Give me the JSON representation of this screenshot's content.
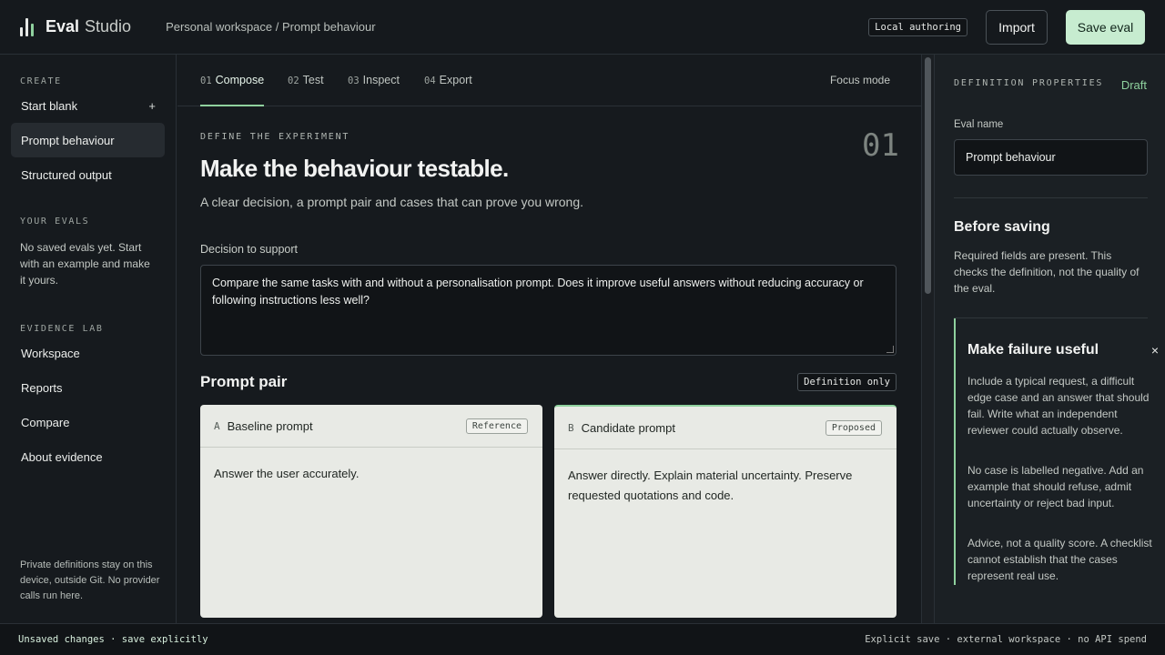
{
  "app": {
    "name_bold": "Eval",
    "name_light": "Studio",
    "breadcrumb": "Personal workspace / Prompt behaviour"
  },
  "topbar": {
    "mode_badge": "Local authoring",
    "import_label": "Import",
    "save_label": "Save eval"
  },
  "sidebar": {
    "create_heading": "CREATE",
    "start_blank": "Start blank",
    "plus": "+",
    "create_items": [
      "Prompt behaviour",
      "Structured output"
    ],
    "your_evals_heading": "YOUR EVALS",
    "your_evals_note": "No saved evals yet. Start with an example and make it yours.",
    "evidence_heading": "EVIDENCE LAB",
    "evidence_items": [
      "Workspace",
      "Reports",
      "Compare",
      "About evidence"
    ],
    "footer_note": "Private definitions stay on this device, outside Git. No provider calls run here."
  },
  "tabs": [
    {
      "num": "01",
      "label": "Compose"
    },
    {
      "num": "02",
      "label": "Test"
    },
    {
      "num": "03",
      "label": "Inspect"
    },
    {
      "num": "04",
      "label": "Export"
    }
  ],
  "focus_mode": "Focus mode",
  "main": {
    "eyebrow": "DEFINE THE EXPERIMENT",
    "step_number": "01",
    "title": "Make the behaviour testable.",
    "subtitle": "A clear decision, a prompt pair and cases that can prove you wrong.",
    "decision_label": "Decision to support",
    "decision_value": "Compare the same tasks with and without a personalisation prompt. Does it improve useful answers without reducing accuracy or following instructions less well?",
    "prompt_pair_title": "Prompt pair",
    "definition_badge": "Definition only",
    "baseline": {
      "letter": "A",
      "title": "Baseline prompt",
      "tag": "Reference",
      "body": "Answer the user accurately."
    },
    "candidate": {
      "letter": "B",
      "title": "Candidate prompt",
      "tag": "Proposed",
      "body": "Answer directly. Explain material uncertainty. Preserve requested quotations and code."
    }
  },
  "right_panel": {
    "heading": "DEFINITION PROPERTIES",
    "status": "Draft",
    "eval_name_label": "Eval name",
    "eval_name_value": "Prompt behaviour",
    "before_saving_title": "Before saving",
    "before_saving_text": "Required fields are present. This checks the definition, not the quality of the eval.",
    "failure_title": "Make failure useful",
    "close": "×",
    "failure_p1": "Include a typical request, a difficult edge case and an answer that should fail. Write what an independent reviewer could actually observe.",
    "failure_p2": "No case is labelled negative. Add an example that should refuse, admit uncertainty or reject bad input.",
    "failure_p3": "Advice, not a quality score. A checklist cannot establish that the cases represent real use."
  },
  "status": {
    "left": "Unsaved changes · save explicitly",
    "right": "Explicit save · external workspace · no API spend"
  },
  "colors": {
    "accent": "#8fd19e",
    "background": "#161a1e",
    "card": "#e8eae5"
  }
}
